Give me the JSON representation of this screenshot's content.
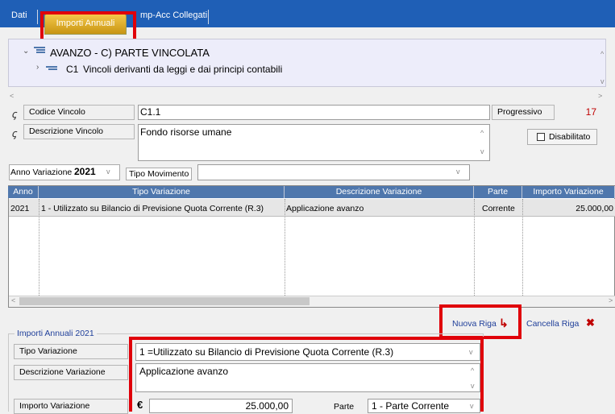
{
  "tabs": {
    "dati": "Dati",
    "importi_annuali": "Importi Annuali",
    "imp_acc": "mp-Acc Collegati"
  },
  "tree": {
    "parent": "AVANZO - C) PARTE VINCOLATA",
    "child_code": "C1",
    "child_label": "Vincoli derivanti da leggi e dai principi contabili"
  },
  "form": {
    "codice_label": "Codice Vincolo",
    "codice_value": "C1.1",
    "progressivo_label": "Progressivo",
    "progressivo_value": "17",
    "descrizione_label": "Descrizione Vincolo",
    "descrizione_value": "Fondo risorse umane",
    "disabilitato_label": "Disabilitato"
  },
  "filters": {
    "anno_label": "Anno Variazione",
    "anno_value": "2021",
    "tipo_mov_label": "Tipo Movimento",
    "tipo_mov_value": ""
  },
  "grid": {
    "headers": [
      "Anno",
      "Tipo Variazione",
      "Descrizione Variazione",
      "Parte",
      "Importo Variazione"
    ],
    "rows": [
      [
        "2021",
        "1 - Utilizzato su Bilancio di Previsione Quota Corrente (R.3)",
        "Applicazione avanzo",
        "Corrente",
        "25.000,00"
      ]
    ]
  },
  "actions": {
    "nuova_riga": "Nuova Riga",
    "cancella_riga": "Cancella Riga"
  },
  "detail": {
    "group_title": "Importi Annuali 2021",
    "tipo_label": "Tipo Variazione",
    "tipo_value": "1 =Utilizzato su Bilancio di Previsione Quota Corrente (R.3)",
    "descr_label": "Descrizione Variazione",
    "descr_value": "Applicazione avanzo",
    "importo_label": "Importo Variazione",
    "currency": "€",
    "importo_value": "25.000,00",
    "parte_label": "Parte",
    "parte_value": "1 - Parte Corrente"
  },
  "colors": {
    "tabbar": "#1f5fb6",
    "grid_header": "#4f77ad",
    "highlight": "#e0000a"
  }
}
